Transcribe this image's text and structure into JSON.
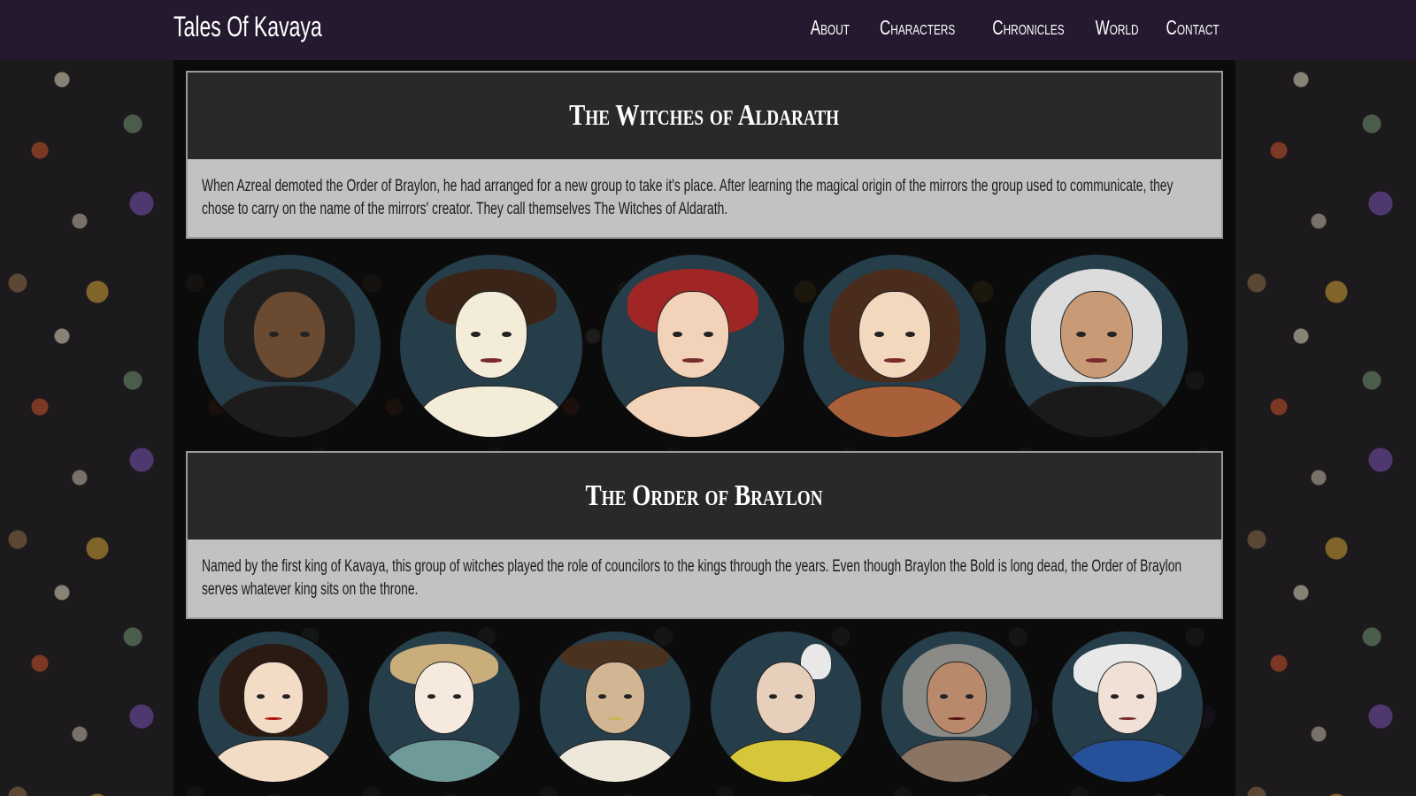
{
  "header": {
    "brand": "Tales Of Kavaya",
    "nav": [
      "About",
      "Characters",
      "Chronicles",
      "World",
      "Contact"
    ]
  },
  "colors": {
    "navbar": "#24192f",
    "section_header": "#292929",
    "section_text_bg": "#c2c2c2",
    "portrait_bg": "#263d4a"
  },
  "sections": [
    {
      "title": "The Witches of Aldarath",
      "description": "When Azreal demoted the Order of Braylon, he had arranged for a new group to take it's place. After learning the magical origin of the mirrors the group used to communicate, they chose to carry on the name of the mirrors' creator. They call themselves The Witches of Aldarath."
    },
    {
      "title": "The Order of Braylon",
      "description": "Named by the first king of Kavaya, this group of witches played the role of councilors to the kings through the years. Even though Braylon the Bold is long dead, the Order of Braylon serves whatever king sits on the throne."
    }
  ]
}
